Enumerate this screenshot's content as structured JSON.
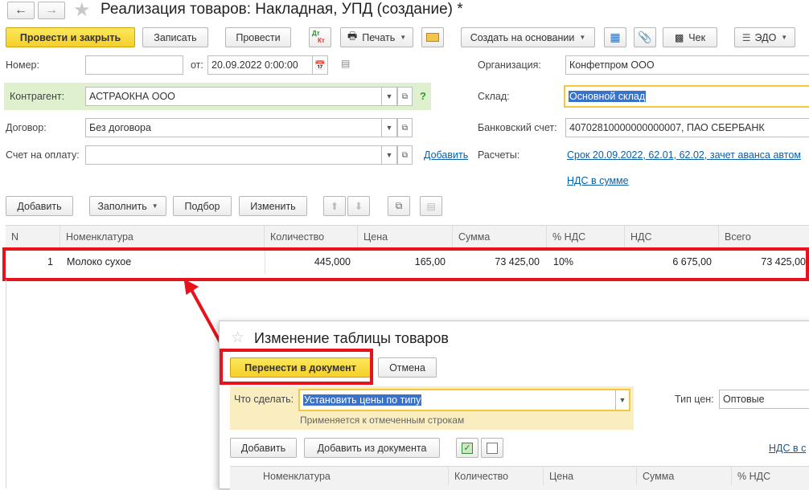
{
  "header": {
    "title": "Реализация товаров: Накладная, УПД (создание) *"
  },
  "toolbar": {
    "post_close": "Провести и закрыть",
    "save": "Записать",
    "post": "Провести",
    "dtkt_dt": "Дт",
    "dtkt_kt": "Кт",
    "print": "Печать",
    "create_based": "Создать на основании",
    "check": "Чек",
    "edo": "ЭДО"
  },
  "form": {
    "number_label": "Номер:",
    "number_value": "",
    "date_label": "от:",
    "date_value": "20.09.2022  0:00:00",
    "org_label": "Организация:",
    "org_value": "Конфетпром ООО",
    "counterparty_label": "Контрагент:",
    "counterparty_value": "АСТРАОКНА ООО",
    "help_mark": "?",
    "warehouse_label": "Склад:",
    "warehouse_value": "Основной склад",
    "contract_label": "Договор:",
    "contract_value": "Без договора",
    "bank_label": "Банковский счет:",
    "bank_value": "40702810000000000007, ПАО СБЕРБАНК",
    "invoice_label": "Счет на оплату:",
    "invoice_value": "",
    "add_link": "Добавить",
    "settlements_label": "Расчеты:",
    "settlements_value": "Срок 20.09.2022, 62.01, 62.02, зачет аванса автом",
    "vat_link": "НДС в сумме"
  },
  "table_toolbar": {
    "add": "Добавить",
    "fill": "Заполнить",
    "pick": "Подбор",
    "change": "Изменить"
  },
  "table": {
    "headers": [
      "N",
      "Номенклатура",
      "Количество",
      "Цена",
      "Сумма",
      "% НДС",
      "НДС",
      "Всего"
    ],
    "rows": [
      {
        "n": "1",
        "item": "Молоко сухое",
        "qty": "445,000",
        "price": "165,00",
        "sum": "73 425,00",
        "vat_rate": "10%",
        "vat": "6 675,00",
        "total": "73 425,00"
      }
    ]
  },
  "dialog": {
    "title": "Изменение таблицы товаров",
    "transfer": "Перенести в документ",
    "cancel": "Отмена",
    "action_label": "Что сделать:",
    "action_value": "Установить цены по типу",
    "action_hint": "Применяется к отмеченным строкам",
    "price_type_label": "Тип цен:",
    "price_type_value": "Оптовые",
    "add": "Добавить",
    "add_from_doc": "Добавить из документа",
    "vat_link": "НДС в с",
    "headers": [
      "Номенклатура",
      "Количество",
      "Цена",
      "Сумма",
      "% НДС"
    ]
  },
  "colors": {
    "accent_yellow": "#f5cf2b",
    "highlight_red": "#e8121c",
    "counterparty_bg": "#dff0cf",
    "link": "#0b5fa5",
    "selection": "#3a72c9"
  }
}
